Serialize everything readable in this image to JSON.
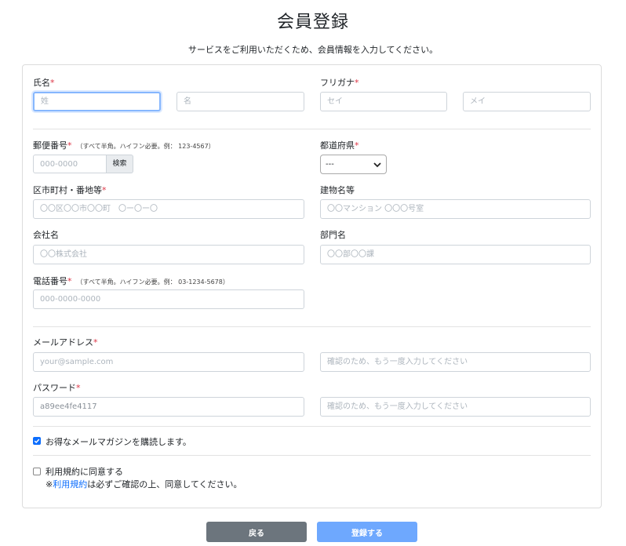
{
  "page": {
    "title": "会員登録",
    "subtitle": "サービスをご利用いただくため、会員情報を入力してください。"
  },
  "form": {
    "name": {
      "label": "氏名",
      "required": "*",
      "last_placeholder": "姓",
      "first_placeholder": "名"
    },
    "kana": {
      "label": "フリガナ",
      "required": "*",
      "last_placeholder": "セイ",
      "first_placeholder": "メイ"
    },
    "postal": {
      "label": "郵便番号",
      "required": "*",
      "hint": "（すべて半角。ハイフン必要。例： 123-4567）",
      "placeholder": "000-0000",
      "search_label": "検索"
    },
    "prefecture": {
      "label": "都道府県",
      "required": "*",
      "selected": "---"
    },
    "address": {
      "label": "区市町村・番地等",
      "required": "*",
      "placeholder": "〇〇区〇〇市〇〇町　〇ー〇ー〇"
    },
    "building": {
      "label": "建物名等",
      "placeholder": "〇〇マンション 〇〇〇号室"
    },
    "company": {
      "label": "会社名",
      "placeholder": "〇〇株式会社"
    },
    "department": {
      "label": "部門名",
      "placeholder": "〇〇部〇〇課"
    },
    "phone": {
      "label": "電話番号",
      "required": "*",
      "hint": "（すべて半角。ハイフン必要。例： 03-1234-5678）",
      "placeholder": "000-0000-0000"
    },
    "email": {
      "label": "メールアドレス",
      "required": "*",
      "placeholder": "your@sample.com",
      "confirm_placeholder": "確認のため、もう一度入力してください"
    },
    "password": {
      "label": "パスワード",
      "required": "*",
      "value": "a89ee4fe4117",
      "confirm_placeholder": "確認のため、もう一度入力してください"
    },
    "newsletter": {
      "label": "お得なメールマガジンを購読します。",
      "checked": true
    },
    "terms": {
      "label": "利用規約に同意する",
      "note_prefix": "※",
      "note_link": "利用規約",
      "note_suffix": "は必ずご確認の上、同意してください。",
      "checked": false
    }
  },
  "buttons": {
    "back": "戻る",
    "submit": "登録する"
  },
  "colors": {
    "primary": "#0d6efd",
    "required": "#dc3545",
    "back_button": "#6c757d",
    "submit_button": "#6ea8fe"
  },
  "icons": {
    "select_arrow": "chevron-down-icon",
    "checkbox_checked": "checkmark-icon"
  }
}
